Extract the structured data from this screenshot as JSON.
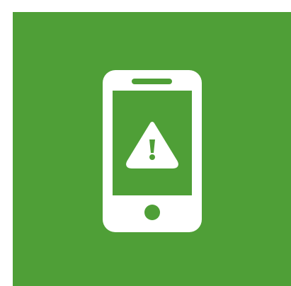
{
  "tile": {
    "background_color": "#4f9f37",
    "icon_color": "#ffffff",
    "icon": "mobile-phone-warning-icon",
    "badge_icon": "warning-triangle-icon"
  }
}
